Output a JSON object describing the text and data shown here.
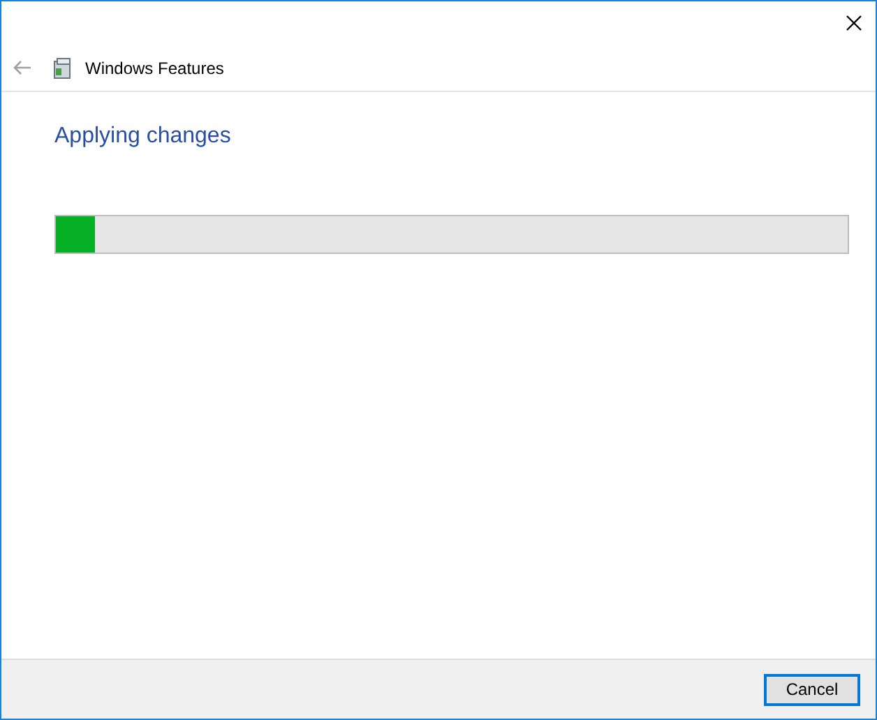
{
  "header": {
    "title": "Windows Features",
    "back_disabled": true
  },
  "heading": "Applying changes",
  "progress": {
    "level": 0.05
  },
  "buttons": [
    {
      "label": "Cancel",
      "default": true
    }
  ]
}
